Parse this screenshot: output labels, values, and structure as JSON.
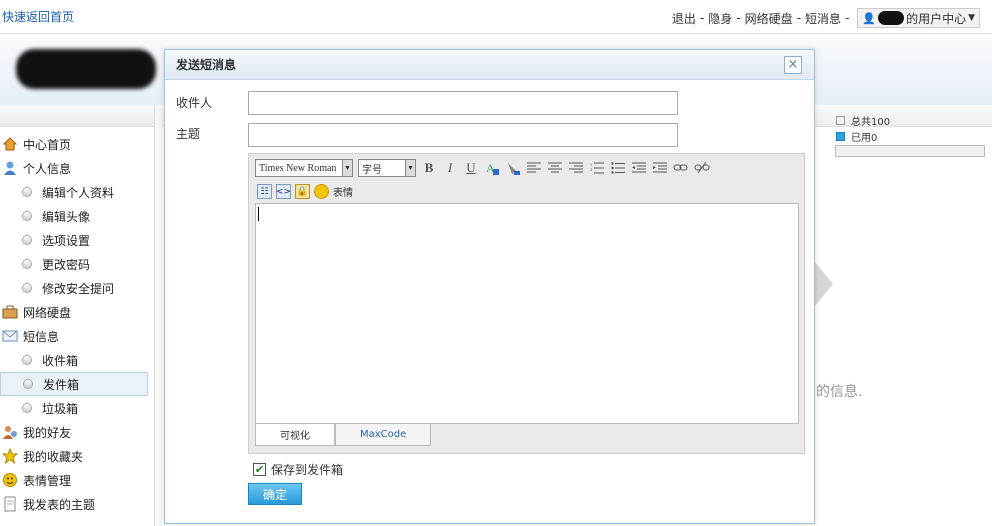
{
  "topbar": {
    "home_link": "快速返回首页",
    "links": [
      "退出",
      "隐身",
      "网络硬盘",
      "短消息"
    ],
    "separator": " - ",
    "user_center": "的用户中心"
  },
  "sidebar": {
    "items": [
      {
        "label": "中心首页",
        "kind": "top",
        "icon": "home-icon"
      },
      {
        "label": "个人信息",
        "kind": "top",
        "icon": "user-icon"
      },
      {
        "label": "编辑个人资料",
        "kind": "sub"
      },
      {
        "label": "编辑头像",
        "kind": "sub"
      },
      {
        "label": "选项设置",
        "kind": "sub"
      },
      {
        "label": "更改密码",
        "kind": "sub"
      },
      {
        "label": "修改安全提问",
        "kind": "sub"
      },
      {
        "label": "网络硬盘",
        "kind": "top",
        "icon": "briefcase-icon"
      },
      {
        "label": "短信息",
        "kind": "top",
        "icon": "envelope-icon"
      },
      {
        "label": "收件箱",
        "kind": "sub"
      },
      {
        "label": "发件箱",
        "kind": "sub",
        "active": true
      },
      {
        "label": "垃圾箱",
        "kind": "sub"
      },
      {
        "label": "我的好友",
        "kind": "top",
        "icon": "friends-icon"
      },
      {
        "label": "我的收藏夹",
        "kind": "top",
        "icon": "star-icon"
      },
      {
        "label": "表情管理",
        "kind": "top",
        "icon": "smiley-icon"
      },
      {
        "label": "我发表的主题",
        "kind": "top",
        "icon": "document-icon"
      }
    ]
  },
  "stats": {
    "total": "总共100",
    "used": "已用0",
    "used_fraction": 0
  },
  "background_text": "的信息.",
  "dialog": {
    "title": "发送短消息",
    "close": "×",
    "recipient_label": "收件人",
    "recipient_value": "",
    "subject_label": "主题",
    "subject_value": "",
    "editor": {
      "font_family": "Times New Roman",
      "font_size": "字号",
      "emoticon_label": "表情",
      "tabs": [
        "可视化",
        "MaxCode"
      ],
      "content": ""
    },
    "save_to_outbox_label": "保存到发件箱",
    "save_to_outbox_checked": true,
    "submit_label": "确定"
  },
  "colors": {
    "accent": "#2a9ad8",
    "link": "#1a5fb4",
    "border": "#9ec3e0"
  }
}
